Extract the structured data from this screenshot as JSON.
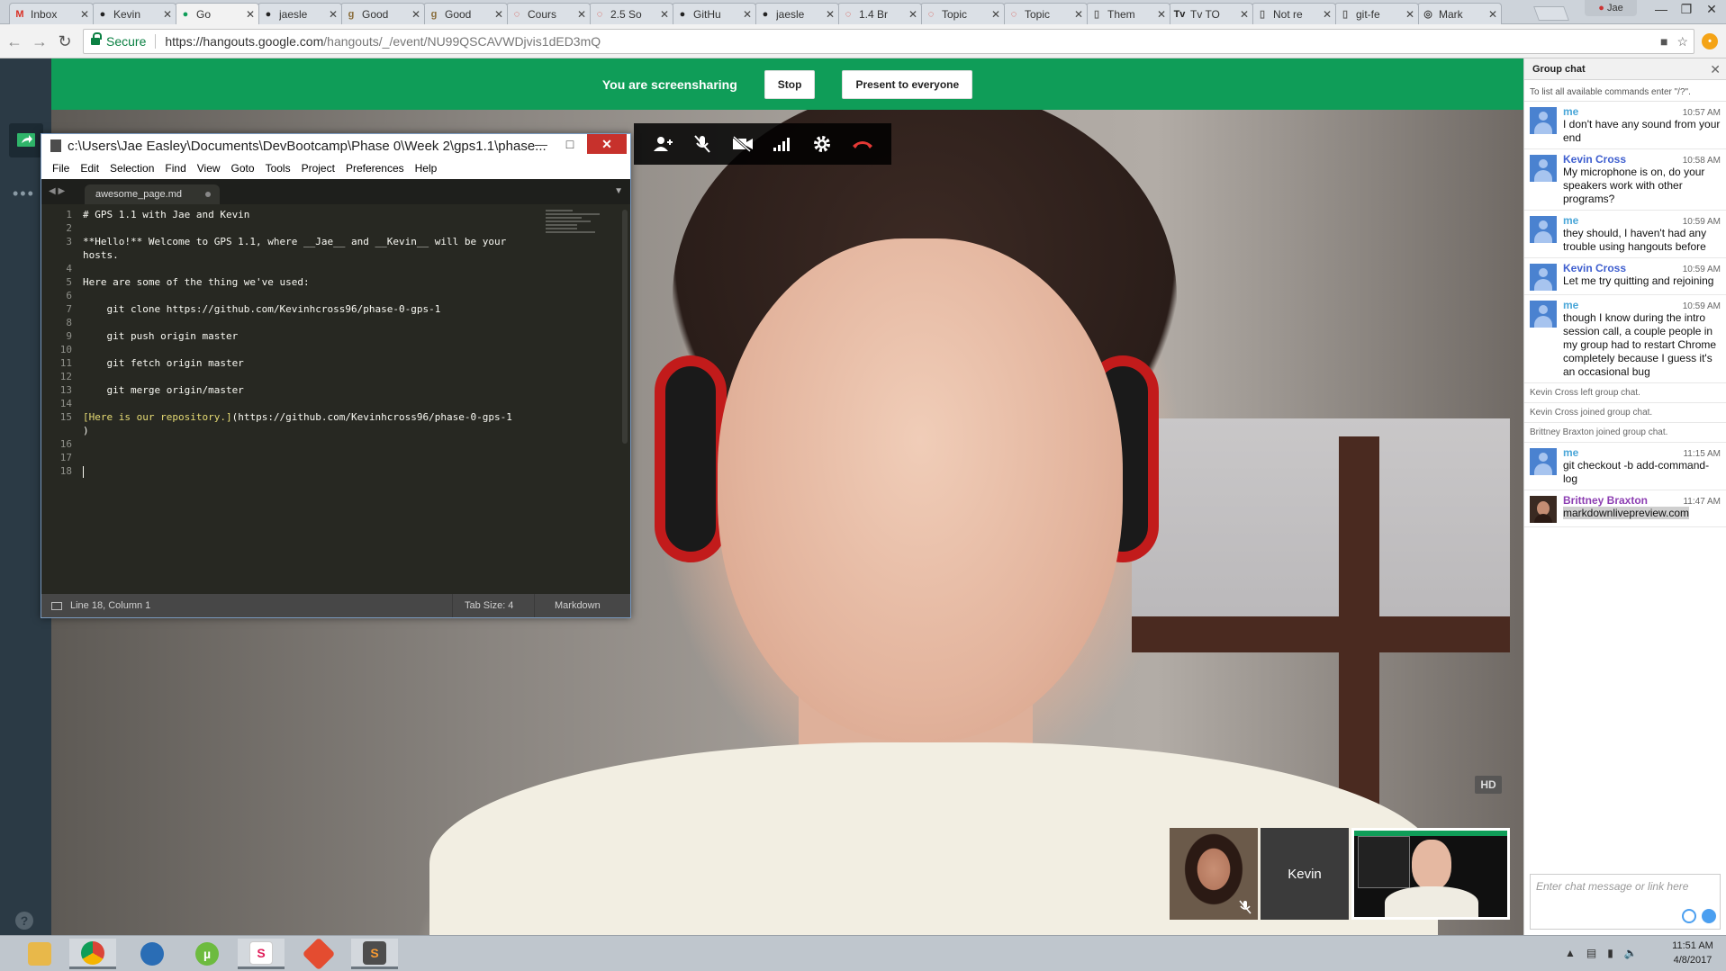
{
  "browser": {
    "tabs": [
      {
        "title": "Inbox",
        "icon": "gmail-icon",
        "active": false
      },
      {
        "title": "Kevin",
        "icon": "github-icon",
        "active": false
      },
      {
        "title": "Go",
        "icon": "hangouts-icon",
        "active": true
      },
      {
        "title": "jaesle",
        "icon": "github-icon",
        "active": false
      },
      {
        "title": "Good",
        "icon": "goodreads-icon",
        "active": false
      },
      {
        "title": "Good",
        "icon": "goodreads-icon",
        "active": false
      },
      {
        "title": "Cours",
        "icon": "loading-icon",
        "active": false
      },
      {
        "title": "2.5 So",
        "icon": "loading-icon",
        "active": false
      },
      {
        "title": "GitHu",
        "icon": "github-icon",
        "active": false
      },
      {
        "title": "jaesle",
        "icon": "github-icon",
        "active": false
      },
      {
        "title": "1.4 Br",
        "icon": "loading-icon",
        "active": false
      },
      {
        "title": "Topic",
        "icon": "loading-icon",
        "active": false
      },
      {
        "title": "Topic",
        "icon": "loading-icon",
        "active": false
      },
      {
        "title": "Them",
        "icon": "page-icon",
        "active": false
      },
      {
        "title": "Tv TO",
        "icon": "tv-icon",
        "active": false
      },
      {
        "title": "Not re",
        "icon": "page-icon",
        "active": false
      },
      {
        "title": "git-fe",
        "icon": "page-icon",
        "active": false
      },
      {
        "title": "Mark",
        "icon": "markdown-icon",
        "active": false
      }
    ],
    "user_name": "Jae",
    "secure_label": "Secure",
    "url_host": "https://hangouts.google.com",
    "url_path": "/hangouts/_/event/NU99QSCAVWDjvis1dED3mQ"
  },
  "banner": {
    "text": "You are screensharing",
    "stop_label": "Stop",
    "present_label": "Present to everyone"
  },
  "call": {
    "hd_label": "HD",
    "participants": [
      {
        "name": "",
        "kind": "video",
        "muted": true
      },
      {
        "name": "Kevin",
        "kind": "placeholder",
        "muted": false
      },
      {
        "name": "",
        "kind": "screenshare",
        "muted": false
      }
    ]
  },
  "editor": {
    "title": "c:\\Users\\Jae Easley\\Documents\\DevBootcamp\\Phase 0\\Week 2\\gps1.1\\phase...",
    "menu": [
      "File",
      "Edit",
      "Selection",
      "Find",
      "View",
      "Goto",
      "Tools",
      "Project",
      "Preferences",
      "Help"
    ],
    "tab_name": "awesome_page.md",
    "line_numbers": [
      "1",
      "2",
      "3",
      "",
      "4",
      "5",
      "6",
      "7",
      "8",
      "9",
      "10",
      "11",
      "12",
      "13",
      "14",
      "15",
      "",
      "16",
      "17",
      "18"
    ],
    "status_position": "Line 18, Column 1",
    "status_tabsize": "Tab Size: 4",
    "status_syntax": "Markdown"
  },
  "chat": {
    "title": "Group chat",
    "hint": "To list all available commands enter \"/?\".",
    "input_placeholder": "Enter chat message or link here",
    "messages": [
      {
        "type": "msg",
        "who": "me",
        "time": "10:57 AM",
        "text": "I don't have any sound from your end"
      },
      {
        "type": "msg",
        "who": "Kevin Cross",
        "time": "10:58 AM",
        "text": "My microphone is on, do your speakers work with other programs?"
      },
      {
        "type": "msg",
        "who": "me",
        "time": "10:59 AM",
        "text": "they should, I haven't had any trouble using hangouts before"
      },
      {
        "type": "msg",
        "who": "Kevin Cross",
        "time": "10:59 AM",
        "text": "Let me try quitting and rejoining"
      },
      {
        "type": "msg",
        "who": "me",
        "time": "10:59 AM",
        "text": "though I know during the intro session call, a couple people in my group had to restart Chrome completely because I guess it's an occasional bug"
      },
      {
        "type": "sys",
        "text": "Kevin Cross left group chat."
      },
      {
        "type": "sys",
        "text": "Kevin Cross joined group chat."
      },
      {
        "type": "sys",
        "text": "Brittney Braxton joined group chat."
      },
      {
        "type": "msg",
        "who": "me",
        "time": "11:15 AM",
        "text": "git checkout -b add-command-log"
      },
      {
        "type": "msg",
        "who": "Brittney Braxton",
        "time": "11:47 AM",
        "text": "markdownlivepreview.com"
      }
    ]
  },
  "taskbar": {
    "apps": [
      "file-explorer-icon",
      "chrome-icon",
      "globe-icon",
      "utorrent-icon",
      "slack-icon",
      "git-icon",
      "sublime-icon"
    ],
    "time": "11:51 AM",
    "date": "4/8/2017"
  },
  "colors": {
    "banner_green": "#0f9d58",
    "editor_bg": "#272822",
    "me_name": "#4aa6d8",
    "kevin_name": "#3f5fcf",
    "brittney_name": "#8d3fb3"
  }
}
